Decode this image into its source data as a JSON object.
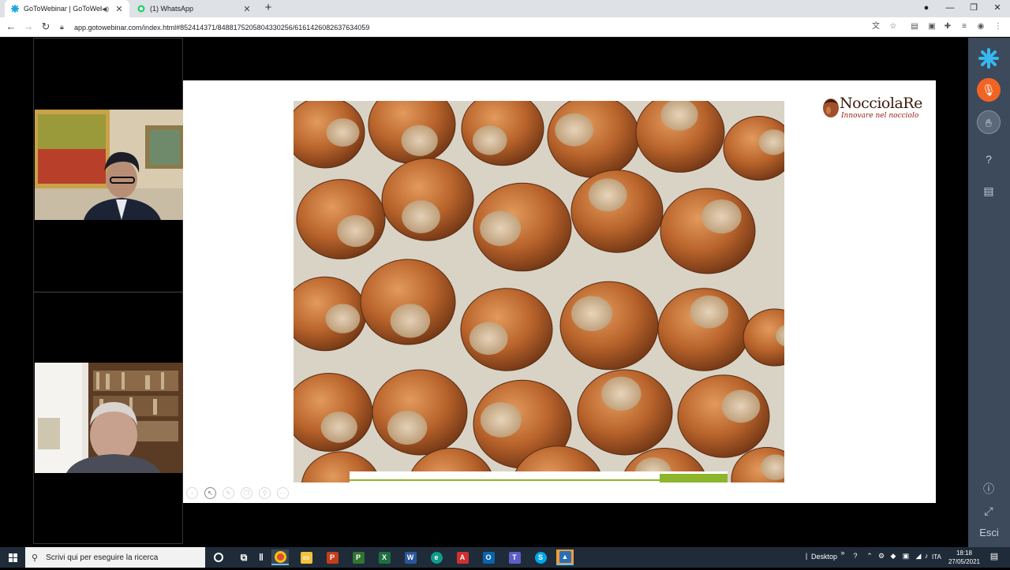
{
  "browser": {
    "tabs": [
      {
        "title": "GoToWebinar | GoToWebinar",
        "muted_audio": true,
        "active": true
      },
      {
        "title": "(1) WhatsApp",
        "active": false
      }
    ],
    "url": "app.gotowebinar.com/index.html#852414371/848817520580433025​6/6161426082637634059"
  },
  "slide": {
    "logo_brand": "NocciolaRe",
    "logo_tagline": "Innovare nel nocciolo",
    "progress": 0.82
  },
  "panel": {
    "exit_label": "Esci"
  },
  "taskbar": {
    "search_placeholder": "Scrivi qui per eseguire la ricerca",
    "desktop_label": "Desktop",
    "language": "ITA",
    "time": "18:18",
    "date": "27/05/2021"
  },
  "colors": {
    "panel_bg": "#3c4a5b",
    "mic_accent": "#f26423",
    "progress_green": "#8db52b",
    "taskbar_bg": "#1f2b38"
  }
}
